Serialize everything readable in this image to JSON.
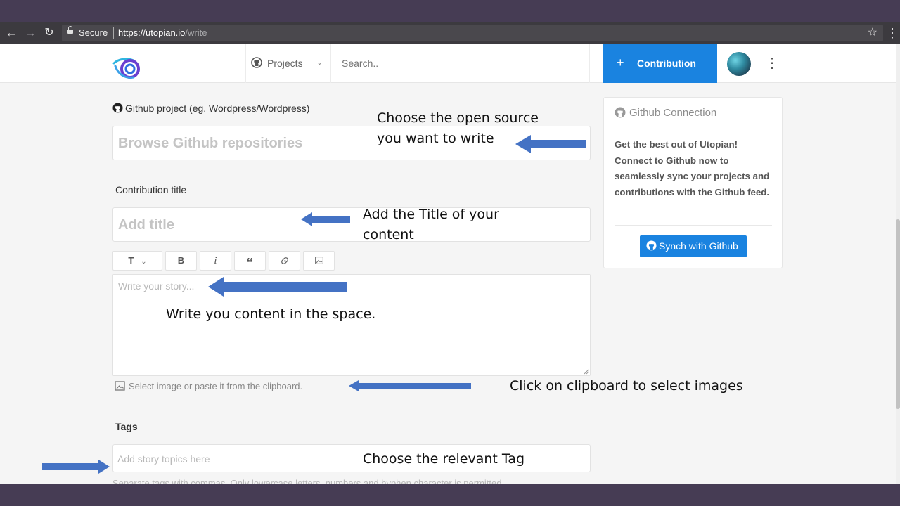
{
  "browser": {
    "secure_label": "Secure",
    "url_host": "https://utopian.io",
    "url_path": "/write"
  },
  "header": {
    "projects_label": "Projects",
    "search_placeholder": "Search..",
    "contribution_plus": "+",
    "contribution_label": "Contribution"
  },
  "form": {
    "github_project_label": "Github project (eg. Wordpress/Wordpress)",
    "github_project_placeholder": "Browse Github repositories",
    "title_label": "Contribution title",
    "title_placeholder": "Add title",
    "toolbar": {
      "text_size": "T",
      "bold": "B",
      "italic": "i",
      "quote": "“",
      "link": "link-icon",
      "image": "image-icon"
    },
    "story_placeholder": "Write your story...",
    "upload_hint": "Select image or paste it from the clipboard.",
    "tags_label": "Tags",
    "tags_placeholder": "Add story topics here",
    "tags_help": "Separate tags with commas. Only lowercase letters, numbers and hyphen character is permitted."
  },
  "sidebar": {
    "title": "Github Connection",
    "description": "Get the best out of Utopian! Connect to Github now to seamlessly sync your projects and contributions with the Github feed.",
    "sync_label": "Synch with Github"
  },
  "annotations": {
    "open_source": "Choose the open source you want to write",
    "title_hint": "Add the Title of your content",
    "content_hint": "Write you content in the space.",
    "clipboard_hint": "Click on clipboard to select images",
    "tag_hint": "Choose the relevant Tag"
  },
  "colors": {
    "accent": "#1a83e0",
    "annotation_arrow": "#4472c4",
    "frame": "#463c54"
  }
}
